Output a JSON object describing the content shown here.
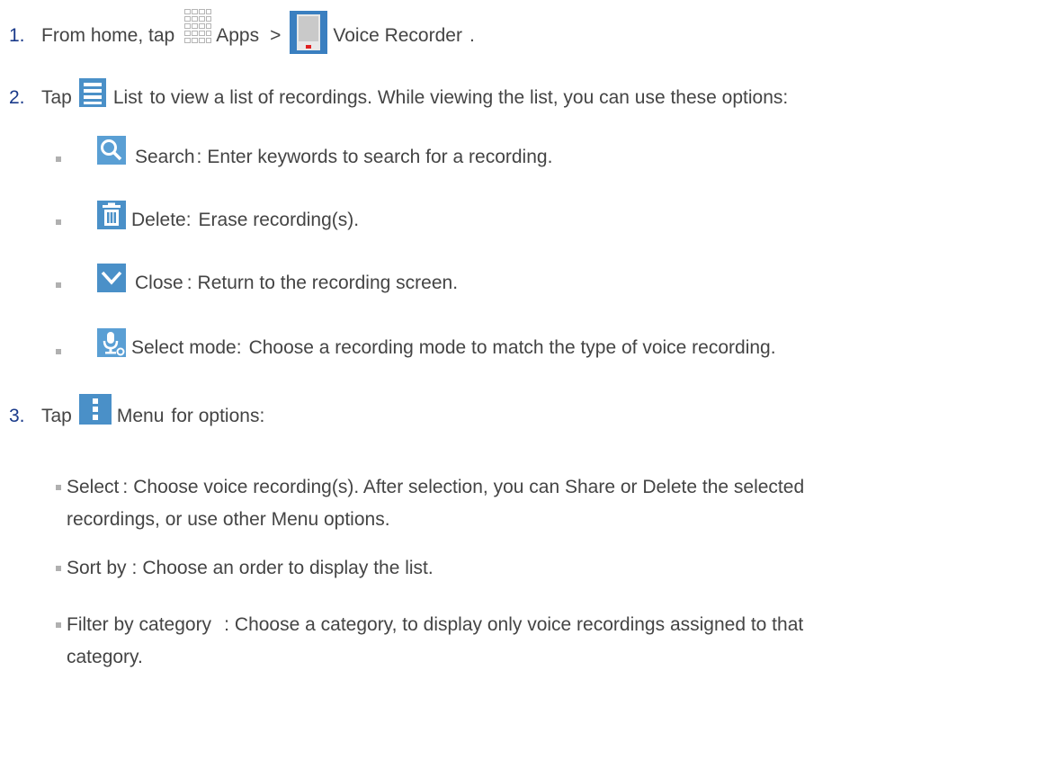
{
  "steps": [
    {
      "number": "1.",
      "pre": "From home, tap",
      "apps_label": "Apps",
      "separator": ">",
      "recorder_label": "Voice Recorder",
      "tail": "."
    },
    {
      "number": "2.",
      "pre": "Tap",
      "list_label": "List",
      "rest": "to view a list of recordings. While viewing the list, you can use these options:"
    },
    {
      "number": "3.",
      "pre": "Tap",
      "menu_label": "Menu",
      "rest": "for options:"
    }
  ],
  "list_options": [
    {
      "label": "Search",
      "sep": ":",
      "desc": "Enter keywords to search for a recording.",
      "icon": "search-icon"
    },
    {
      "label": "Delete",
      "sep": ":",
      "desc": "Erase recording(s).",
      "icon": "trash-icon"
    },
    {
      "label": "Close",
      "sep": ":",
      "desc": "Return to the recording screen.",
      "icon": "chevron-down-icon"
    },
    {
      "label": "Select mode",
      "sep": ":",
      "desc": "Choose a recording mode to match the type of voice recording.",
      "icon": "mic-settings-icon"
    }
  ],
  "menu_options": [
    {
      "label": "Select",
      "sep": ":",
      "desc_line1": "Choose voice recording(s). After selection, you can Share or Delete the selected",
      "desc_line2": "recordings, or use other Menu options."
    },
    {
      "label": "Sort by",
      "sep": ":",
      "desc_line1": "Choose an order to display the list."
    },
    {
      "label": "Filter by category",
      "sep": ":",
      "desc_line1": "Choose a category, to display only voice recordings assigned to that",
      "desc_line2": "category."
    }
  ],
  "colors": {
    "text": "#444444",
    "step_number": "#1a3a8a",
    "icon_blue": "#4a90c8",
    "icon_bg": "#5a9fd4",
    "bullet": "#b0b0b0"
  }
}
